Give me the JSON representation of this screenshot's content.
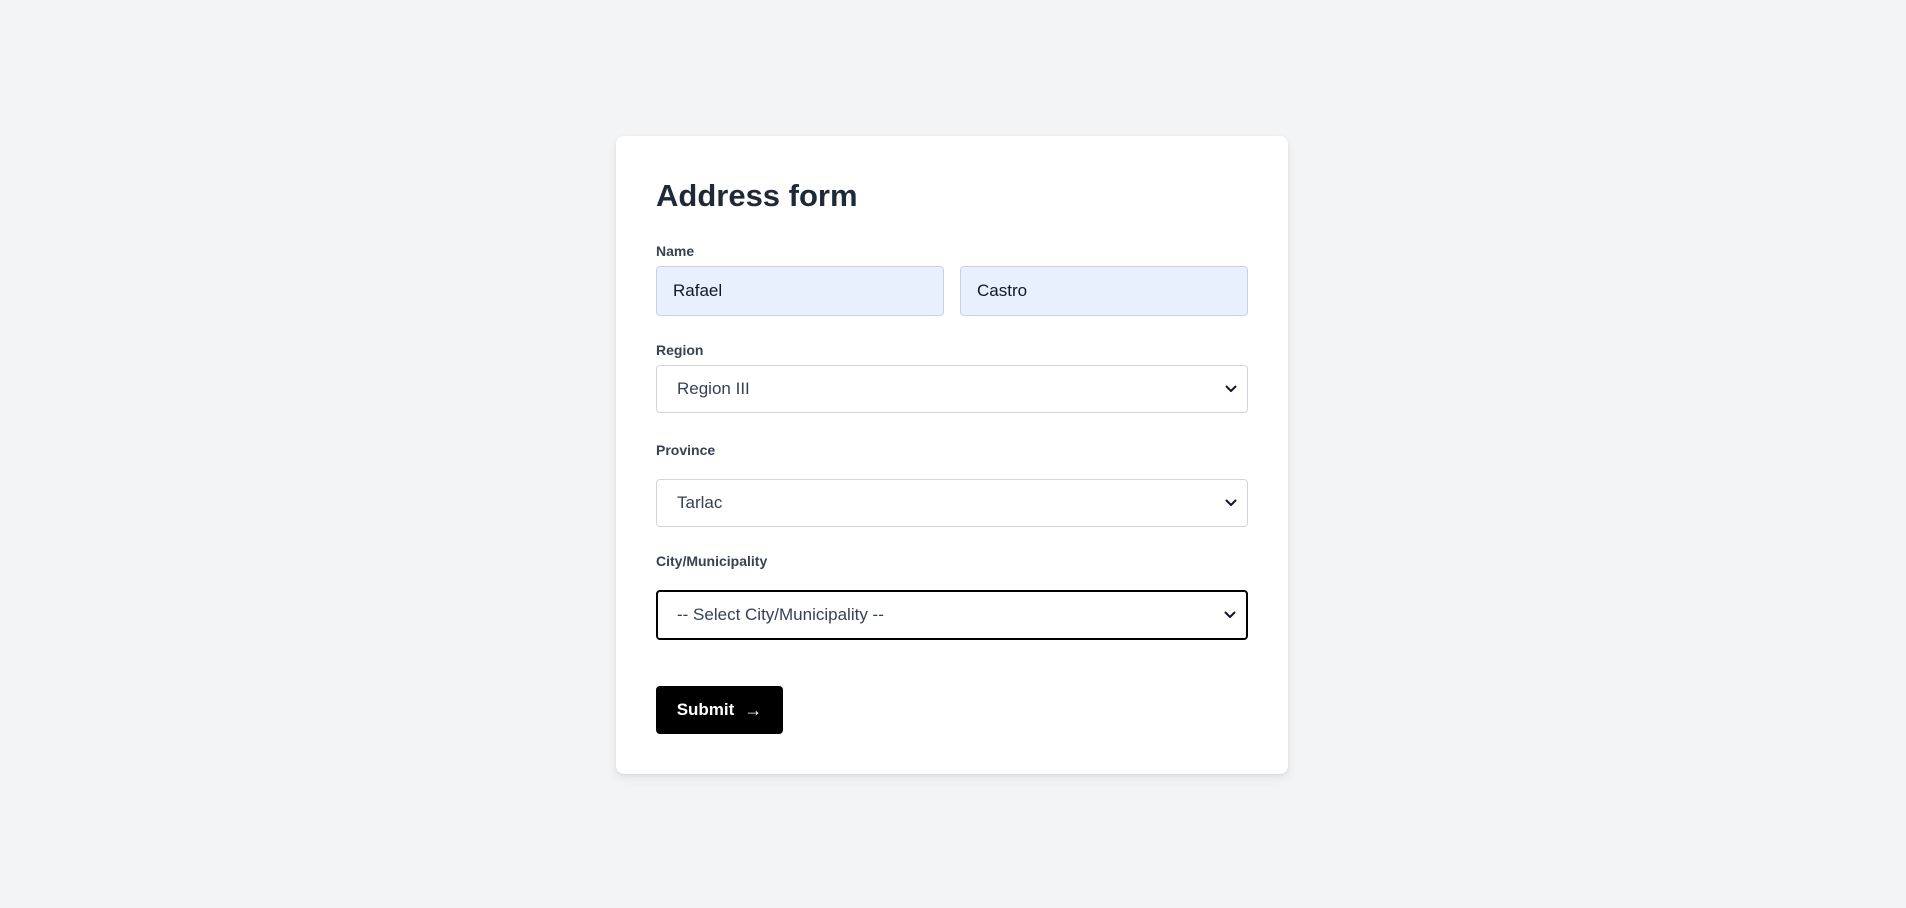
{
  "form": {
    "title": "Address form",
    "name": {
      "label": "Name",
      "first_value": "Rafael",
      "last_value": "Castro"
    },
    "region": {
      "label": "Region",
      "selected": "Region III"
    },
    "province": {
      "label": "Province",
      "selected": "Tarlac"
    },
    "city": {
      "label": "City/Municipality",
      "selected": "-- Select City/Municipality --"
    },
    "submit": {
      "label": "Submit",
      "icon": "arrow-right-icon",
      "glyph": "→"
    }
  },
  "colors": {
    "page_bg": "#f3f4f6",
    "card_bg": "#ffffff",
    "autofill_bg": "#e8f0fe",
    "button_bg": "#000000",
    "heading": "#1f2937"
  }
}
